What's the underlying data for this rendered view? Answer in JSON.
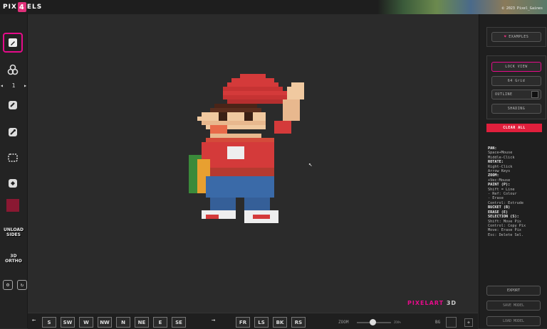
{
  "app": {
    "logo_left": "PIX",
    "logo_badge": "4",
    "logo_right": "ELS"
  },
  "banner": {
    "credit": "© 2023 Pixel_Gaines"
  },
  "tools": [
    {
      "name": "pencil-icon",
      "active": true
    },
    {
      "name": "shapes-icon",
      "active": false
    },
    {
      "name": "eraser-icon",
      "active": false
    },
    {
      "name": "eyedropper-icon",
      "active": false
    },
    {
      "name": "selection-icon",
      "active": false
    },
    {
      "name": "fill-bucket-icon",
      "active": false
    }
  ],
  "brush": {
    "size": "1",
    "dec": "◂",
    "inc": "▸"
  },
  "current_color": "#8a1832",
  "modes": {
    "unload": "UNLOAD\nSIDES",
    "ortho": "3D ORTHO"
  },
  "right": {
    "examples": "EXAMPLES",
    "lock_view": "LOCK VIEW",
    "grid": "64 Grid",
    "outline": "OUTLINE",
    "shading": "SHADING",
    "clear_all": "CLEAR ALL",
    "export": "EXPORT",
    "save_model": "SAVE MODEL",
    "load_model": "LOAD MODEL"
  },
  "help": [
    {
      "h": "PAN:",
      "t": "Space+Mouse\nMiddle-Click"
    },
    {
      "h": "ROTATE:",
      "t": "Right-Click\nArrow Keys"
    },
    {
      "h": "ZOOM:",
      "t": "+Vec:Mouse"
    },
    {
      "h": "PAINT (P):",
      "t": "Shift = Line\n- Ref: Colour\n- Erase\nControl: Extrude"
    },
    {
      "h": "BUCKET (B)",
      "t": ""
    },
    {
      "h": "ERASE (E)",
      "t": ""
    },
    {
      "h": "SELECTION (S):",
      "t": "Shift: Move Pix\nControl: Copy Pix\nMove: Erase Pix\nEsc: Delete Sel."
    }
  ],
  "views": [
    "S",
    "SW",
    "W",
    "NW",
    "N",
    "NE",
    "E",
    "SE"
  ],
  "views2": [
    "FR",
    "LS",
    "BK",
    "RS"
  ],
  "zoom": {
    "label": "ZOOM",
    "value": "ZOO%",
    "level": 0.45
  },
  "bg": {
    "label": "BG"
  },
  "watermark": {
    "text": "PIXELART",
    "suffix": "3D"
  },
  "colors": {
    "accent": "#e60b8a",
    "danger": "#e01f3c",
    "bg": "#2b2b2b"
  }
}
